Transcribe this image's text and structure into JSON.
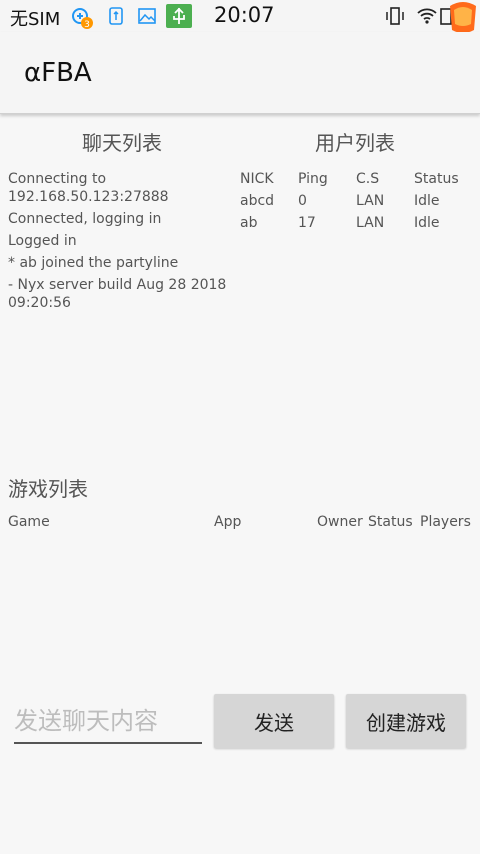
{
  "status_bar": {
    "sim_text": "无SIM",
    "time": "20:07",
    "badge_count": "3",
    "icons": [
      "notification-icon",
      "usb-icon",
      "image-icon",
      "usb-debug-icon",
      "vibrate-icon",
      "wifi-icon",
      "battery-icon",
      "lantern-icon"
    ]
  },
  "app_bar": {
    "title": "αFBA"
  },
  "chat": {
    "title": "聊天列表",
    "lines": [
      "Connecting to 192.168.50.123:27888",
      "Connected, logging in",
      "Logged in",
      "* ab joined the partyline",
      "- Nyx server build Aug 28 2018 09:20:56"
    ]
  },
  "users": {
    "title": "用户列表",
    "columns": [
      "NICK",
      "Ping",
      "C.S",
      "Status"
    ],
    "rows": [
      [
        "abcd",
        "0",
        "LAN",
        "Idle"
      ],
      [
        "ab",
        "17",
        "LAN",
        "Idle"
      ]
    ]
  },
  "games": {
    "title": "游戏列表",
    "columns": [
      "Game",
      "App",
      "Owner",
      "Status",
      "Players"
    ]
  },
  "composer": {
    "placeholder": "发送聊天内容",
    "send_label": "发送",
    "create_label": "创建游戏"
  },
  "colors": {
    "background": "#f7f7f7",
    "button": "#d6d6d6",
    "usb_green": "#4caf50",
    "accent_blue": "#2196f3",
    "badge_orange": "#ff9800"
  }
}
